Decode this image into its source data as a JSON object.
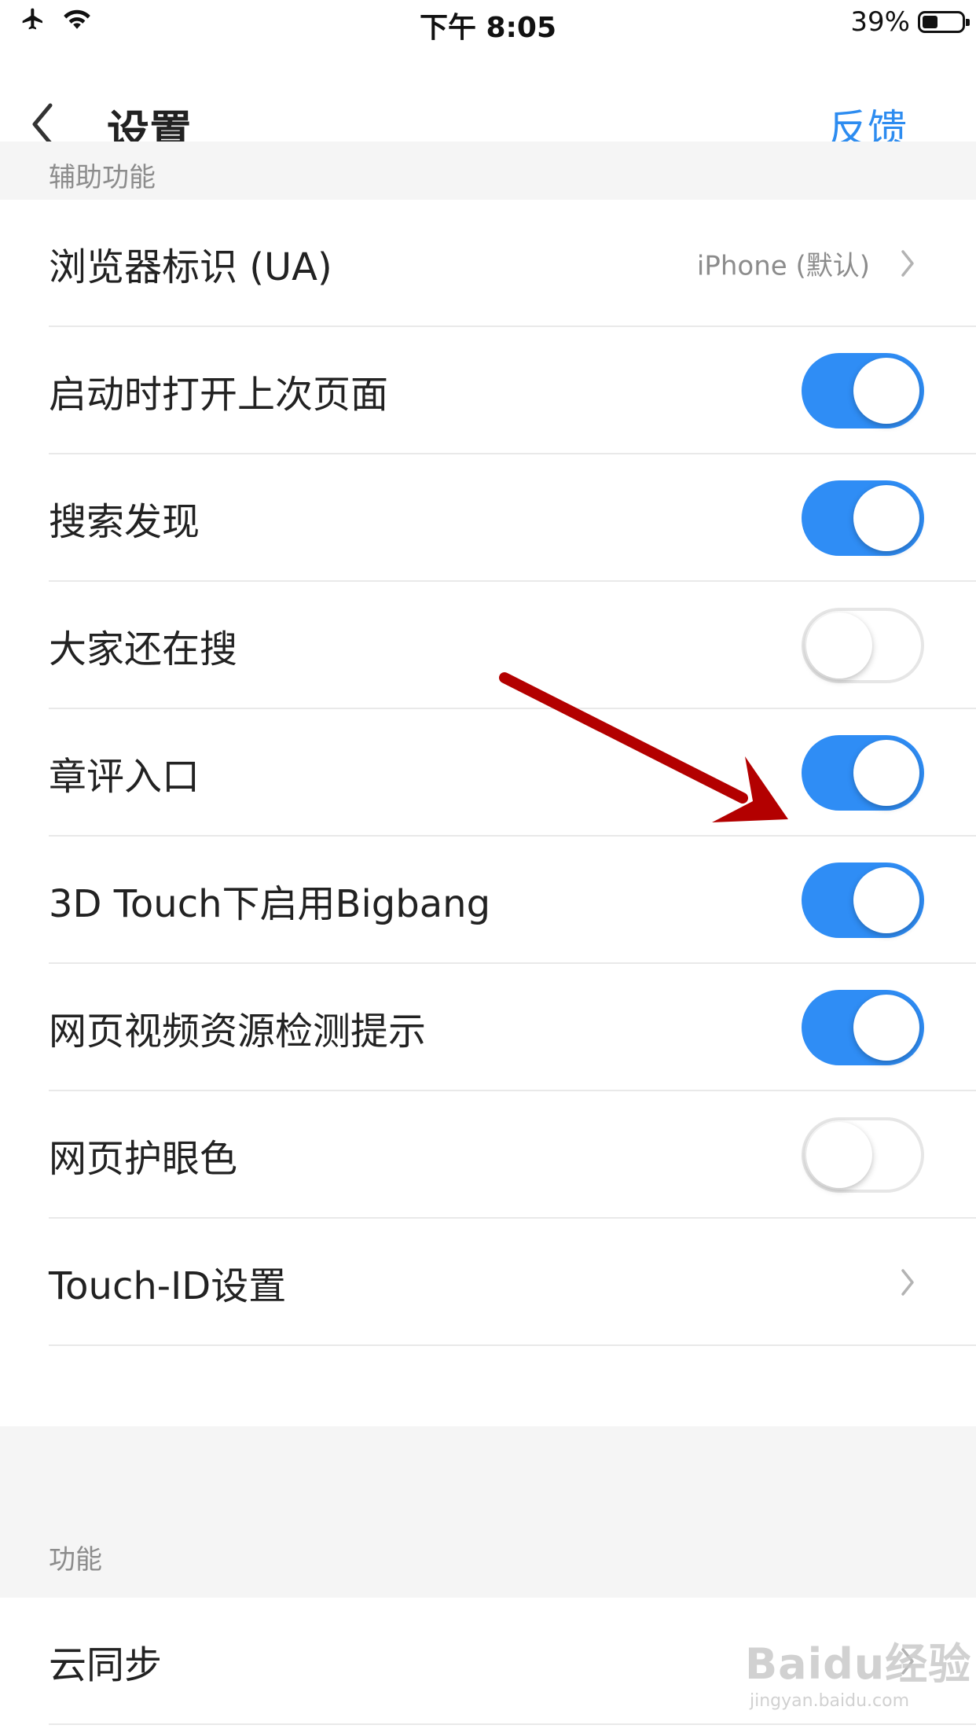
{
  "status_bar": {
    "time": "下午 8:05",
    "battery_percent": "39%",
    "battery_level": 0.39
  },
  "nav": {
    "title": "设置",
    "action": "反馈"
  },
  "sections": [
    {
      "header": "辅助功能",
      "rows": [
        {
          "label": "浏览器标识 (UA)",
          "type": "link",
          "value": "iPhone (默认)"
        },
        {
          "label": "启动时打开上次页面",
          "type": "toggle",
          "on": true
        },
        {
          "label": "搜索发现",
          "type": "toggle",
          "on": true
        },
        {
          "label": "大家还在搜",
          "type": "toggle",
          "on": false
        },
        {
          "label": "章评入口",
          "type": "toggle",
          "on": true
        },
        {
          "label": "3D Touch下启用Bigbang",
          "type": "toggle",
          "on": true
        },
        {
          "label": "网页视频资源检测提示",
          "type": "toggle",
          "on": true
        },
        {
          "label": "网页护眼色",
          "type": "toggle",
          "on": false
        },
        {
          "label": "Touch-ID设置",
          "type": "link"
        }
      ]
    },
    {
      "header": "功能",
      "rows": [
        {
          "label": "云同步",
          "type": "link"
        }
      ]
    }
  ],
  "watermark": {
    "brand": "Baidu经验",
    "url": "jingyan.baidu.com"
  },
  "colors": {
    "accent": "#2d8cf0",
    "toggle_on": "#2f8df5",
    "annotation_arrow": "#b30000"
  },
  "icons": [
    "airplane-icon",
    "wifi-icon",
    "battery-icon",
    "back-chevron-icon",
    "chevron-right-icon"
  ]
}
